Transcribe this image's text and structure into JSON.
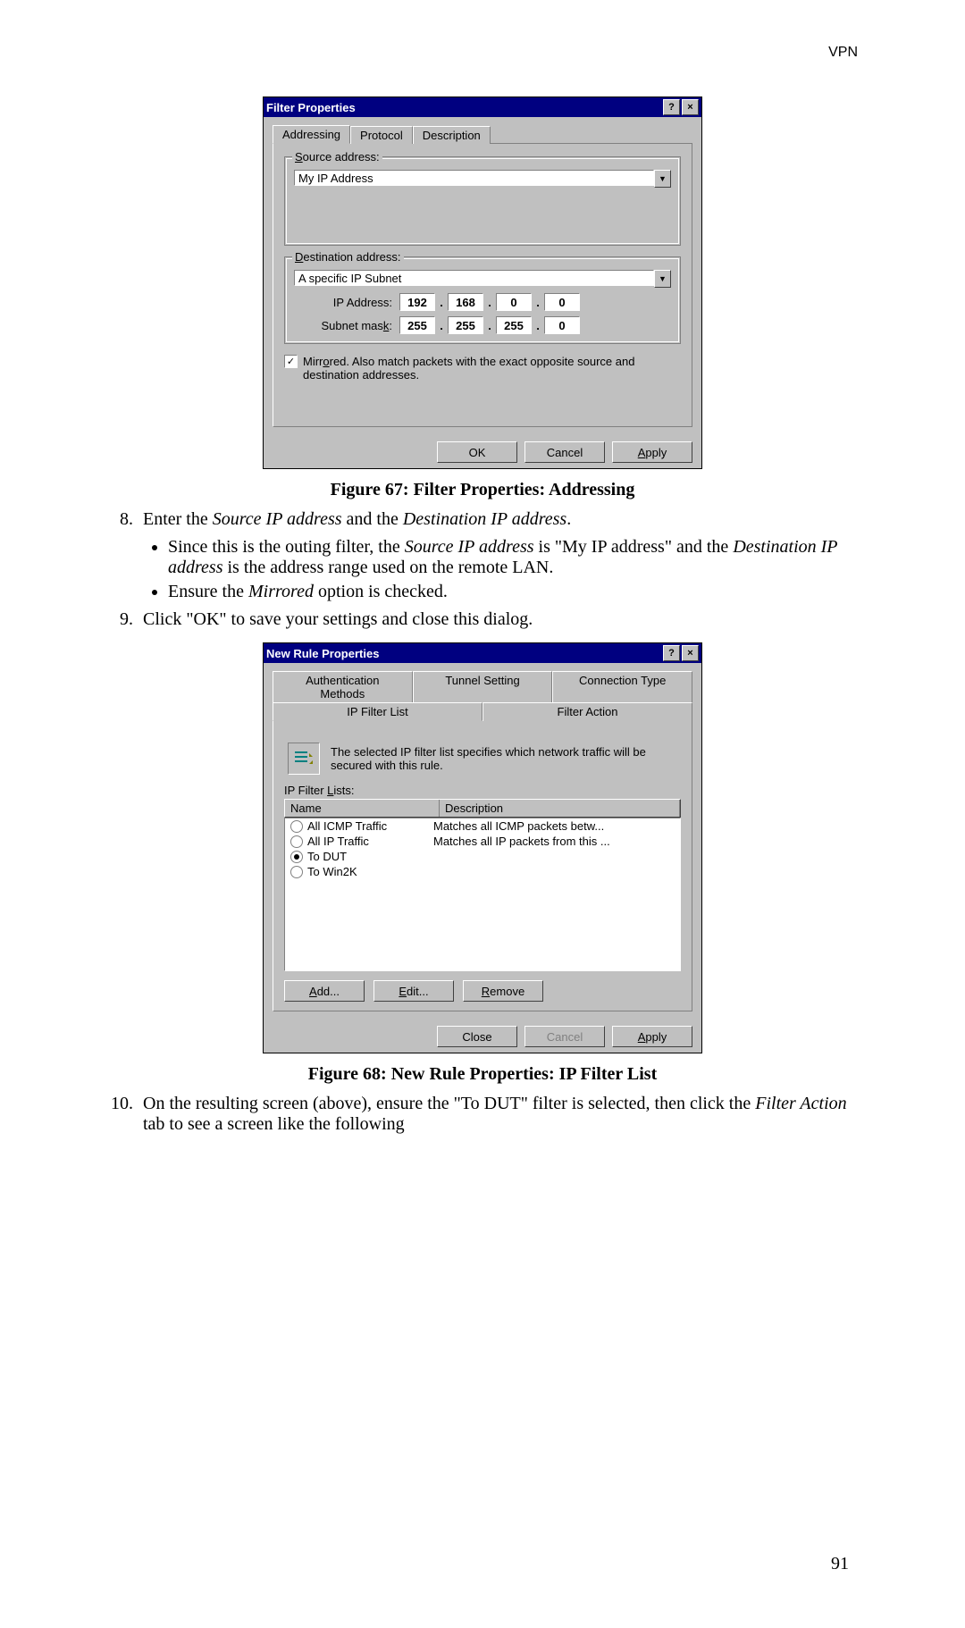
{
  "header": {
    "right": "VPN"
  },
  "pageNumber": "91",
  "figure67": {
    "title": "Filter Properties",
    "tabs": {
      "addressing": "Addressing",
      "protocol": "Protocol",
      "description": "Description"
    },
    "source": {
      "legend": "Source address:",
      "value": "My IP Address"
    },
    "dest": {
      "legend": "Destination address:",
      "value": "A specific IP Subnet",
      "ipLabel": "IP Address:",
      "maskLabel": "Subnet mask:",
      "ip": [
        "192",
        "168",
        "0",
        "0"
      ],
      "mask": [
        "255",
        "255",
        "255",
        "0"
      ]
    },
    "mirrored": {
      "checked": true,
      "text": "Mirrored. Also match packets with the exact opposite source and destination addresses."
    },
    "buttons": {
      "ok": "OK",
      "cancel": "Cancel",
      "apply": "Apply"
    },
    "caption": "Figure 67: Filter Properties: Addressing"
  },
  "body": {
    "step8": "Enter the ",
    "step8_i1": "Source IP address",
    "step8_mid": " and the ",
    "step8_i2": "Destination IP address",
    "step8_end": ".",
    "b1a": "Since this is the outing filter, the ",
    "b1b": "Source IP address",
    "b1c": " is \"My IP address\" and the ",
    "b1d": "Destination IP address",
    "b1e": " is the address range used on the remote LAN.",
    "b2a": "Ensure the ",
    "b2b": "Mirrored",
    "b2c": " option is checked.",
    "step9": "Click \"OK\" to save your settings and close this dialog."
  },
  "figure68": {
    "title": "New Rule Properties",
    "tabsTop": {
      "auth": "Authentication Methods",
      "tunnel": "Tunnel Setting",
      "conn": "Connection Type"
    },
    "tabsBot": {
      "list": "IP Filter List",
      "action": "Filter Action"
    },
    "info": "The selected IP filter list specifies which network traffic will be secured with this rule.",
    "listsLabel": "IP Filter Lists:",
    "cols": {
      "name": "Name",
      "desc": "Description"
    },
    "rows": [
      {
        "sel": false,
        "name": "All ICMP Traffic",
        "desc": "Matches all ICMP packets betw..."
      },
      {
        "sel": false,
        "name": "All IP Traffic",
        "desc": "Matches all IP packets from this ..."
      },
      {
        "sel": true,
        "name": "To DUT",
        "desc": ""
      },
      {
        "sel": false,
        "name": "To Win2K",
        "desc": ""
      }
    ],
    "buttons": {
      "add": "Add...",
      "edit": "Edit...",
      "remove": "Remove",
      "close": "Close",
      "cancel": "Cancel",
      "apply": "Apply"
    },
    "caption": "Figure 68: New Rule Properties: IP Filter List"
  },
  "step10": {
    "a": "On the resulting screen (above), ensure the \"To DUT\" filter is selected, then click the ",
    "b": "Filter Action",
    "c": " tab to see a screen like the following"
  }
}
